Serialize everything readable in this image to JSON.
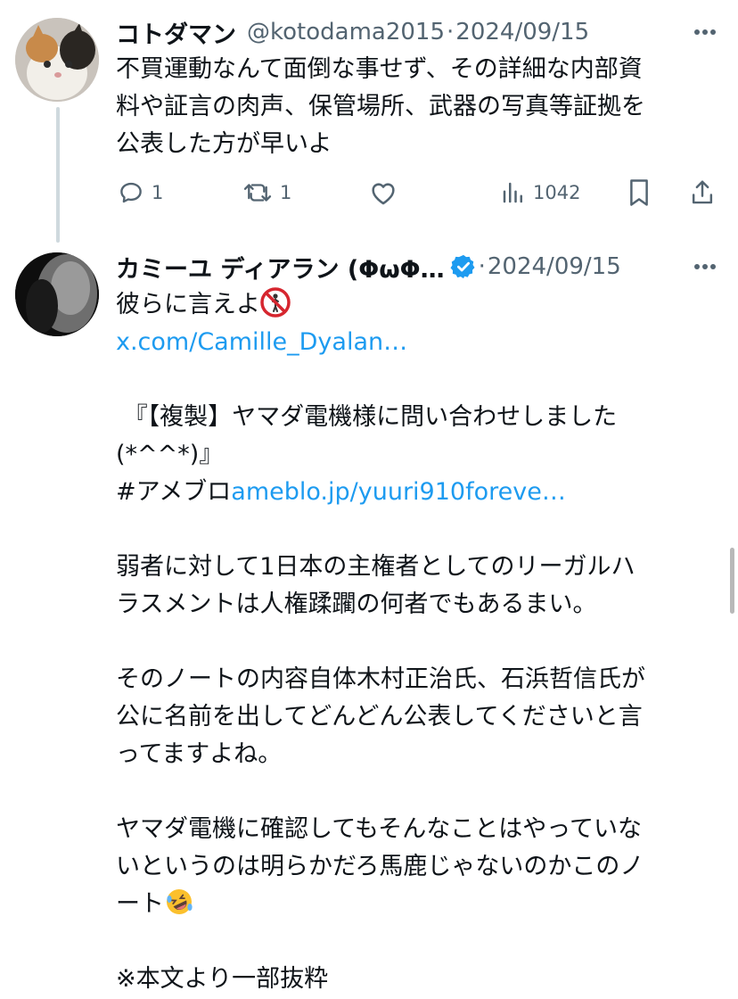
{
  "tweet1": {
    "display_name": "コトダマン",
    "handle": "@kotodama2015",
    "separator": "·",
    "date": "2024/09/15",
    "lines": [
      "不買運動なんて面倒な事せず、その詳細な内部資",
      "料や証言の肉声、保管場所、武器の写真等証拠を",
      "公表した方が早いよ"
    ],
    "replies": "1",
    "reposts": "1",
    "views": "1042"
  },
  "tweet2": {
    "display_name": "カミーユ ディアラン (ΦωΦ…",
    "separator": "·",
    "date": "2024/09/15",
    "line1": "彼らに言えよ",
    "link1": "x.com/Camille_Dyalan…",
    "line_quote1": "『【複製】ヤマダ電機様に問い合わせしました",
    "line_quote2": "(*^^*)』",
    "hashtag": "#アメブロ",
    "link2": "ameblo.jp/yuuri910foreve…",
    "para1_l1": "弱者に対して1日本の主権者としてのリーガルハ",
    "para1_l2": "ラスメントは人権蹂躙の何者でもあるまい。",
    "para2_l1": "そのノートの内容自体木村正治氏、石浜哲信氏が",
    "para2_l2": "公に名前を出してどんどん公表してくださいと言",
    "para2_l3": "ってますよね。",
    "para3_l1": "ヤマダ電機に確認してもそんなことはやっていな",
    "para3_l2": "いというのは明らかだろ馬鹿じゃないのかこのノ",
    "para3_l3": "ート",
    "para4_l1": "※本文より一部抜粋"
  },
  "colors": {
    "link": "#1d9bf0",
    "muted": "#536471",
    "verified": "#1d9bf0",
    "thread_line": "#cfd9de"
  }
}
